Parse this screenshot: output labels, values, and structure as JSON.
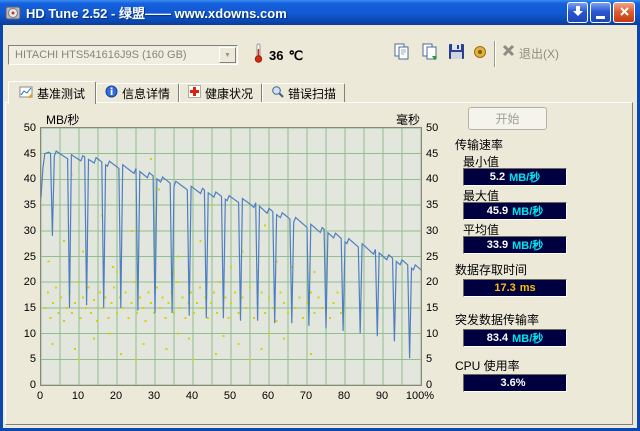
{
  "window": {
    "title": "HD Tune 2.52 - 绿盟—— www.xdowns.com"
  },
  "toolbar": {
    "drive": "HITACHI HTS541616J9S (160 GB)",
    "temperature_value": "36",
    "temperature_unit": "℃",
    "exit_label": "退出(X)"
  },
  "tabs": {
    "active_index": 0,
    "items": [
      {
        "label": "基准测试"
      },
      {
        "label": "信息详情"
      },
      {
        "label": "健康状况"
      },
      {
        "label": "错误扫描"
      }
    ]
  },
  "panel": {
    "start_label": "开始"
  },
  "stats": {
    "group_label": "传输速率",
    "min": {
      "label": "最小值",
      "value": "5.2",
      "unit": "MB/秒"
    },
    "max": {
      "label": "最大值",
      "value": "45.9",
      "unit": "MB/秒"
    },
    "avg": {
      "label": "平均值",
      "value": "33.9",
      "unit": "MB/秒"
    },
    "access": {
      "label": "数据存取时间",
      "value": "17.3",
      "unit": "ms"
    },
    "burst": {
      "label": "突发数据传输率",
      "value": "83.4",
      "unit": "MB/秒"
    },
    "cpu": {
      "label": "CPU 使用率",
      "value": "3.6%",
      "unit": ""
    }
  },
  "colors": {
    "navy_box": "#000040",
    "value_white": "#ffffff",
    "unit_cyan": "#00e5ee",
    "access_yellow": "#ffc000"
  },
  "chart_data": {
    "type": "line+scatter",
    "y_left_label": "MB/秒",
    "y_right_label": "毫秒",
    "xlim": [
      0,
      100
    ],
    "ylim": [
      0,
      50
    ],
    "grid": "on",
    "grid_step": 5,
    "y_ticks": [
      50,
      45,
      40,
      35,
      30,
      25,
      20,
      15,
      10,
      5,
      0
    ],
    "x_ticks": {
      "positions": [
        0,
        10,
        20,
        30,
        40,
        50,
        60,
        70,
        80,
        90,
        100
      ],
      "labels": [
        "0",
        "10",
        "20",
        "30",
        "40",
        "50",
        "60",
        "70",
        "80",
        "90",
        "100%"
      ]
    },
    "plot_bg": "#e3e6dd",
    "grid_color": "#8fbf8f",
    "line_color": "#4f7fc0",
    "dot_color": "#d8d300",
    "line_series_name": "传输速率",
    "scatter_series_name": "存取时间",
    "line_envelope": [
      [
        0,
        37
      ],
      [
        0.8,
        44.5
      ],
      [
        2,
        45.3
      ],
      [
        5,
        44.8
      ],
      [
        10,
        44.2
      ],
      [
        15,
        43.6
      ],
      [
        20,
        42.6
      ],
      [
        25,
        41.6
      ],
      [
        30,
        40.4
      ],
      [
        35,
        39.2
      ],
      [
        40,
        38.2
      ],
      [
        45,
        37.2
      ],
      [
        50,
        36.2
      ],
      [
        55,
        35.4
      ],
      [
        60,
        33.8
      ],
      [
        65,
        32.6
      ],
      [
        70,
        31.2
      ],
      [
        75,
        29.8
      ],
      [
        80,
        28.2
      ],
      [
        85,
        26.8
      ],
      [
        90,
        25.2
      ],
      [
        95,
        23.8
      ],
      [
        100,
        22.4
      ]
    ],
    "line_dips": [
      [
        3,
        29
      ],
      [
        7.5,
        15
      ],
      [
        12,
        15.5
      ],
      [
        16.5,
        15
      ],
      [
        21,
        15
      ],
      [
        25.5,
        14.5
      ],
      [
        30,
        14
      ],
      [
        34.5,
        14
      ],
      [
        39,
        13.5
      ],
      [
        43.5,
        13
      ],
      [
        48,
        13
      ],
      [
        52.5,
        12.5
      ],
      [
        57,
        12.5
      ],
      [
        61.5,
        12
      ],
      [
        66,
        12
      ],
      [
        70.5,
        11.5
      ],
      [
        75,
        11
      ],
      [
        79.5,
        10.5
      ],
      [
        84,
        10
      ],
      [
        88.5,
        9.5
      ],
      [
        93,
        8.5
      ],
      [
        97,
        5.2
      ]
    ],
    "scatter": [
      [
        1,
        15
      ],
      [
        1.8,
        18
      ],
      [
        2.5,
        13
      ],
      [
        3.2,
        16
      ],
      [
        4,
        19
      ],
      [
        4.6,
        14
      ],
      [
        5.3,
        17
      ],
      [
        6,
        12.5
      ],
      [
        6.8,
        15
      ],
      [
        7.5,
        18
      ],
      [
        8.2,
        14
      ],
      [
        9,
        16
      ],
      [
        9.7,
        20
      ],
      [
        10.4,
        13
      ],
      [
        11,
        17
      ],
      [
        11.8,
        15
      ],
      [
        12.5,
        19
      ],
      [
        13.2,
        14
      ],
      [
        14,
        16.5
      ],
      [
        14.8,
        12.5
      ],
      [
        15.5,
        18
      ],
      [
        16.2,
        15
      ],
      [
        17,
        17
      ],
      [
        17.8,
        13
      ],
      [
        18.5,
        16
      ],
      [
        19.2,
        19
      ],
      [
        20,
        14
      ],
      [
        20.8,
        17
      ],
      [
        21.5,
        15
      ],
      [
        22.3,
        18
      ],
      [
        23,
        13
      ],
      [
        23.8,
        16
      ],
      [
        24.5,
        20
      ],
      [
        25.3,
        14
      ],
      [
        26,
        17
      ],
      [
        26.8,
        15
      ],
      [
        27.5,
        12.5
      ],
      [
        28.3,
        18
      ],
      [
        29,
        16
      ],
      [
        29.8,
        14
      ],
      [
        30.5,
        19
      ],
      [
        31.3,
        15
      ],
      [
        32,
        17
      ],
      [
        32.8,
        13
      ],
      [
        33.5,
        16
      ],
      [
        34.3,
        18
      ],
      [
        35,
        14
      ],
      [
        35.8,
        20
      ],
      [
        36.5,
        15
      ],
      [
        37.3,
        17
      ],
      [
        38,
        13
      ],
      [
        38.8,
        16
      ],
      [
        39.5,
        18
      ],
      [
        40.3,
        14
      ],
      [
        41,
        16
      ],
      [
        41.8,
        19
      ],
      [
        42.5,
        15
      ],
      [
        43.3,
        17
      ],
      [
        44,
        13
      ],
      [
        44.8,
        16
      ],
      [
        45.5,
        18
      ],
      [
        46.3,
        14
      ],
      [
        47,
        20
      ],
      [
        47.8,
        15
      ],
      [
        48.5,
        17
      ],
      [
        49.3,
        13
      ],
      [
        50,
        16
      ],
      [
        51,
        18
      ],
      [
        52,
        14
      ],
      [
        53,
        17
      ],
      [
        54,
        15
      ],
      [
        55,
        19
      ],
      [
        56,
        13
      ],
      [
        57,
        16
      ],
      [
        58,
        18
      ],
      [
        59,
        14
      ],
      [
        60,
        17
      ],
      [
        61,
        15
      ],
      [
        62,
        12.5
      ],
      [
        63,
        18
      ],
      [
        64,
        16
      ],
      [
        65,
        14
      ],
      [
        66,
        19
      ],
      [
        67,
        15
      ],
      [
        68,
        17
      ],
      [
        69,
        13
      ],
      [
        70,
        16
      ],
      [
        71,
        18
      ],
      [
        72,
        14
      ],
      [
        73,
        17
      ],
      [
        74,
        15
      ],
      [
        75,
        19
      ],
      [
        76,
        13
      ],
      [
        77,
        16
      ],
      [
        78,
        18
      ],
      [
        79,
        14
      ],
      [
        3,
        8
      ],
      [
        9,
        7
      ],
      [
        14,
        9
      ],
      [
        21,
        6
      ],
      [
        27,
        8
      ],
      [
        33,
        7
      ],
      [
        39,
        9
      ],
      [
        46,
        6
      ],
      [
        52,
        8
      ],
      [
        58,
        7
      ],
      [
        64,
        9
      ],
      [
        71,
        6
      ],
      [
        10,
        5
      ],
      [
        25,
        5
      ],
      [
        40,
        5
      ],
      [
        55,
        5
      ],
      [
        18,
        10
      ],
      [
        36,
        10
      ],
      [
        60,
        10
      ],
      [
        48,
        9.5
      ],
      [
        2,
        24
      ],
      [
        6,
        28
      ],
      [
        11,
        26
      ],
      [
        16,
        33
      ],
      [
        19,
        23
      ],
      [
        24,
        30
      ],
      [
        31,
        38
      ],
      [
        36,
        25
      ],
      [
        42,
        28
      ],
      [
        48,
        22
      ],
      [
        53,
        26
      ],
      [
        59,
        31
      ],
      [
        66,
        23
      ],
      [
        72,
        22
      ],
      [
        8,
        41
      ],
      [
        29,
        44
      ],
      [
        45,
        35
      ],
      [
        62,
        24
      ],
      [
        20,
        22
      ],
      [
        35,
        22
      ],
      [
        50,
        23
      ],
      [
        57,
        22
      ]
    ]
  }
}
